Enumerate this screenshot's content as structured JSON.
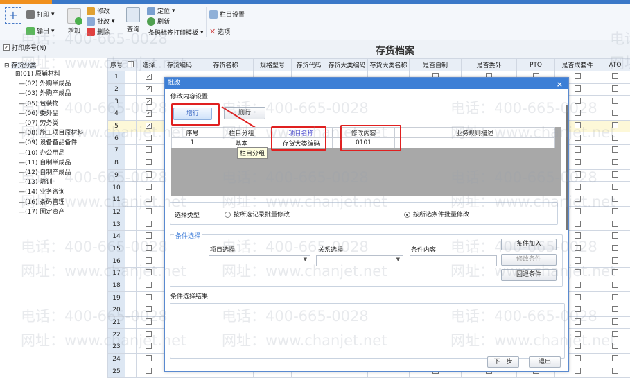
{
  "toolbar": {
    "print": "打印",
    "export": "输出",
    "add": "增加",
    "edit": "修改",
    "batch_edit": "批改",
    "delete": "删除",
    "query": "查询",
    "locate": "定位",
    "refresh": "刷新",
    "barcode_template": "条码标签打印模板",
    "column_settings": "栏目设置",
    "options": "选项"
  },
  "print_seq": {
    "label": "打印序号(N)",
    "checked": true
  },
  "page_title": "存货档案",
  "tree": {
    "root": "存货分类",
    "items": [
      "(01) 原辅材料",
      "(02) 外购半成品",
      "(03) 外购产成品",
      "(05) 包装物",
      "(06) 委外品",
      "(07) 劳务类",
      "(08) 施工项目原材料",
      "(09) 设备备品备件",
      "(10) 办公用品",
      "(11) 自制半成品",
      "(12) 自制产成品",
      "(13) 培训",
      "(14) 业务咨询",
      "(16) 条码管理",
      "(17) 固定资产"
    ]
  },
  "grid": {
    "columns": [
      "序号",
      "",
      "选择",
      "存货编码",
      "存货名称",
      "规格型号",
      "存货代码",
      "存货大类编码",
      "存货大类名称",
      "是否自制",
      "是否委外",
      "PTO",
      "是否成套件",
      "ATO"
    ],
    "selected_rows": [
      1,
      2,
      3,
      4,
      5
    ],
    "highlight_row": 5,
    "row_count": 25
  },
  "dialog": {
    "title": "批改",
    "tab": "修改内容设置",
    "add_row": "增行",
    "delete_row": "删行",
    "columns": [
      "序号",
      "栏目分组",
      "项目名称",
      "修改内容",
      "业务规则描述"
    ],
    "rows": [
      {
        "seq": "1",
        "group": "基本",
        "item": "存货大类编码",
        "value": "0101",
        "desc": ""
      }
    ],
    "tooltip": "栏目分组",
    "select_type_label": "选择类型",
    "radio1": "按所选记录批量修改",
    "radio2": "按所选条件批量修改",
    "radio_selected": 2,
    "cond_group": "条件选择",
    "item_select": "项目选择",
    "relation_select": "关系选择",
    "cond_content": "条件内容",
    "add_cond": "条件加入",
    "edit_cond": "修改条件",
    "back_cond": "回退条件",
    "result_label": "条件选择结果",
    "next": "下一步",
    "exit": "退出"
  },
  "watermark": {
    "phone": "电话：400-665-0028",
    "site": "网址：www.chanjet.net"
  },
  "colors": {
    "accent": "#3d7fd6",
    "highlight": "#e02020"
  }
}
